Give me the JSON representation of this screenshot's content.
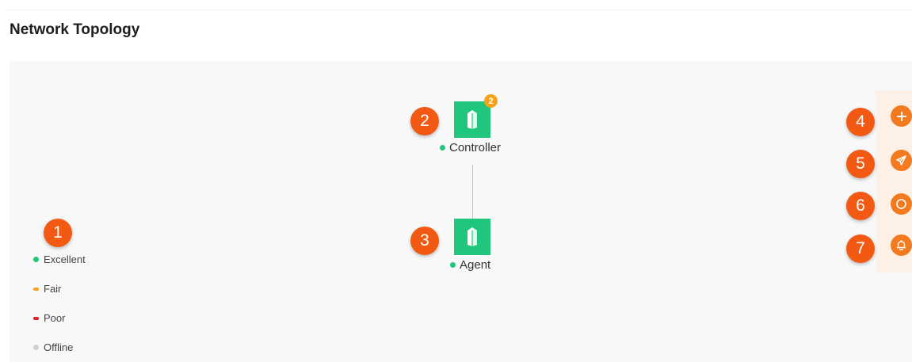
{
  "page": {
    "title": "Network Topology"
  },
  "legend": {
    "items": [
      {
        "label": "Excellent",
        "color": "#1fc67b"
      },
      {
        "label": "Fair",
        "color": "#f7a21a"
      },
      {
        "label": "Poor",
        "color": "#e0202b"
      },
      {
        "label": "Offline",
        "color": "#cfcfcf"
      }
    ]
  },
  "devices": {
    "controller": {
      "label": "Controller",
      "badge": "2",
      "status_color": "#1fc67b"
    },
    "agent": {
      "label": "Agent",
      "status_color": "#1fc67b"
    }
  },
  "callouts": [
    "1",
    "2",
    "3",
    "4",
    "5",
    "6",
    "7"
  ],
  "toolbar": {
    "buttons": [
      {
        "icon": "plus-icon"
      },
      {
        "icon": "send-icon"
      },
      {
        "icon": "power-icon"
      },
      {
        "icon": "alarm-icon"
      }
    ]
  },
  "colors": {
    "accent": "#f47a1f",
    "callout": "#f25a13",
    "device": "#1fc67b",
    "badge": "#f7a21a"
  }
}
